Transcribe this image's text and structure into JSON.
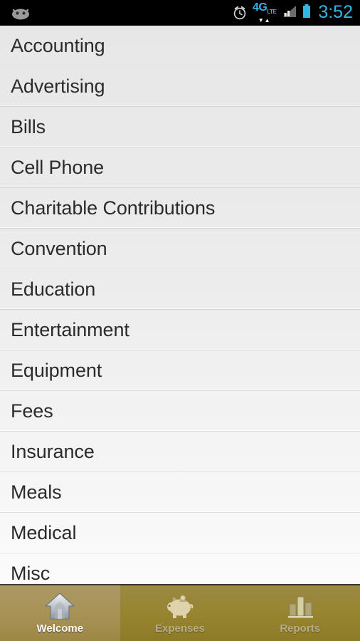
{
  "status_bar": {
    "notification_icon": "android-face-icon",
    "alarm_icon": "alarm-clock-icon",
    "network_label": "4G",
    "network_sub_label": "LTE",
    "data_arrows": "▼▲",
    "signal_icon": "signal-bars-icon",
    "battery_icon": "battery-icon",
    "time": "3:52",
    "accent_color": "#33b5e5",
    "background_color": "#000000"
  },
  "list": {
    "items": [
      {
        "label": "Accounting"
      },
      {
        "label": "Advertising"
      },
      {
        "label": "Bills"
      },
      {
        "label": "Cell Phone"
      },
      {
        "label": "Charitable Contributions"
      },
      {
        "label": "Convention"
      },
      {
        "label": "Education"
      },
      {
        "label": "Entertainment"
      },
      {
        "label": "Equipment"
      },
      {
        "label": "Fees"
      },
      {
        "label": "Insurance"
      },
      {
        "label": "Meals"
      },
      {
        "label": "Medical"
      },
      {
        "label": "Misc"
      }
    ],
    "text_color": "#2b2b2b",
    "background_top_color": "#e7e7e7",
    "background_bottom_color": "#fbfbfb"
  },
  "tab_bar": {
    "background_color": "#96842f",
    "selected_background_color": "#a79256",
    "selected_label_color": "#ffffff",
    "unselected_label_color": "#b9ad8c",
    "tabs": [
      {
        "label": "Welcome",
        "icon": "home-icon",
        "selected": true
      },
      {
        "label": "Expenses",
        "icon": "piggy-bank-icon",
        "selected": false
      },
      {
        "label": "Reports",
        "icon": "bar-chart-icon",
        "selected": false
      }
    ]
  }
}
